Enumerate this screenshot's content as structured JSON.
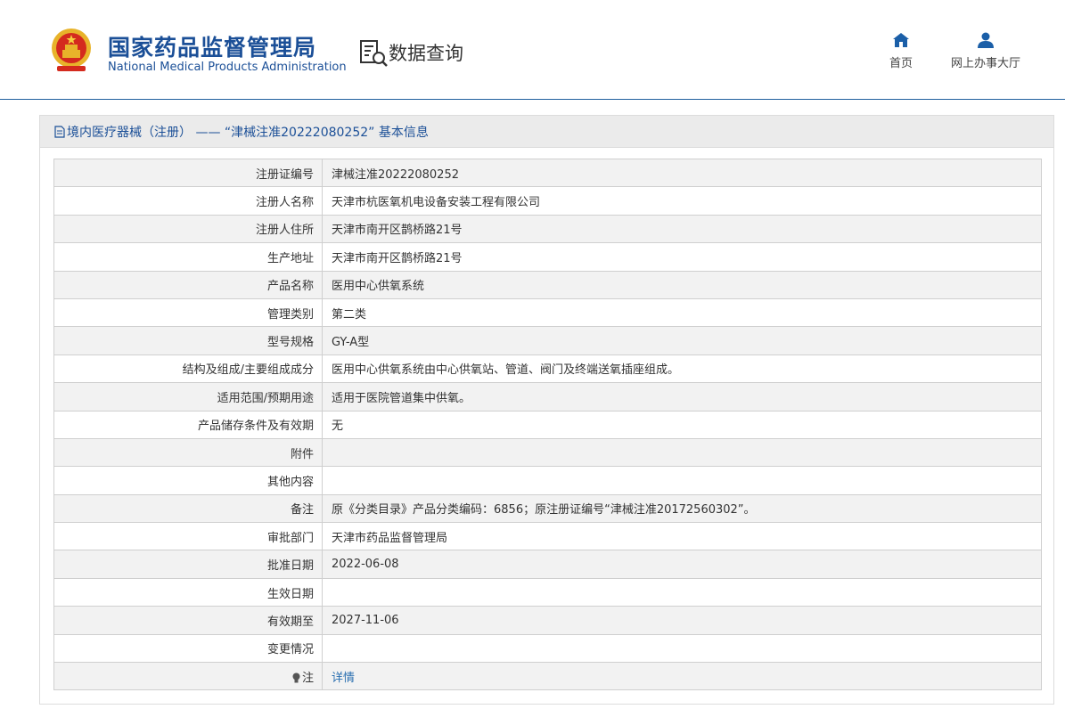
{
  "header": {
    "logo_cn": "国家药品监督管理局",
    "logo_en": "National Medical Products Administration",
    "query_title": "数据查询",
    "nav": [
      {
        "label": "首页",
        "icon": "home-icon"
      },
      {
        "label": "网上办事大厅",
        "icon": "user-icon"
      }
    ]
  },
  "panel": {
    "title": "境内医疗器械（注册）  ——  “津械注准20222080252”  基本信息",
    "rows": [
      {
        "label": "注册证编号",
        "value": "津械注准20222080252"
      },
      {
        "label": "注册人名称",
        "value": "天津市杭医氧机电设备安装工程有限公司"
      },
      {
        "label": "注册人住所",
        "value": "天津市南开区鹊桥路21号"
      },
      {
        "label": "生产地址",
        "value": "天津市南开区鹊桥路21号"
      },
      {
        "label": "产品名称",
        "value": "医用中心供氧系统"
      },
      {
        "label": "管理类别",
        "value": "第二类"
      },
      {
        "label": "型号规格",
        "value": "GY-A型"
      },
      {
        "label": "结构及组成/主要组成成分",
        "value": "医用中心供氧系统由中心供氧站、管道、阀门及终端送氧插座组成。"
      },
      {
        "label": "适用范围/预期用途",
        "value": "适用于医院管道集中供氧。"
      },
      {
        "label": "产品储存条件及有效期",
        "value": "无"
      },
      {
        "label": "附件",
        "value": ""
      },
      {
        "label": "其他内容",
        "value": ""
      },
      {
        "label": "备注",
        "value": "原《分类目录》产品分类编码：6856；原注册证编号“津械注准20172560302”。"
      },
      {
        "label": "审批部门",
        "value": "天津市药品监督管理局"
      },
      {
        "label": "批准日期",
        "value": "2022-06-08"
      },
      {
        "label": "生效日期",
        "value": ""
      },
      {
        "label": "有效期至",
        "value": "2027-11-06"
      },
      {
        "label": "变更情况",
        "value": ""
      },
      {
        "label": "注",
        "value": "详情",
        "icon": "bulb-icon"
      }
    ]
  },
  "colors": {
    "brand_blue": "#1b4f97",
    "link_blue": "#2a6fb0",
    "row_stripe": "#f2f2f2"
  }
}
